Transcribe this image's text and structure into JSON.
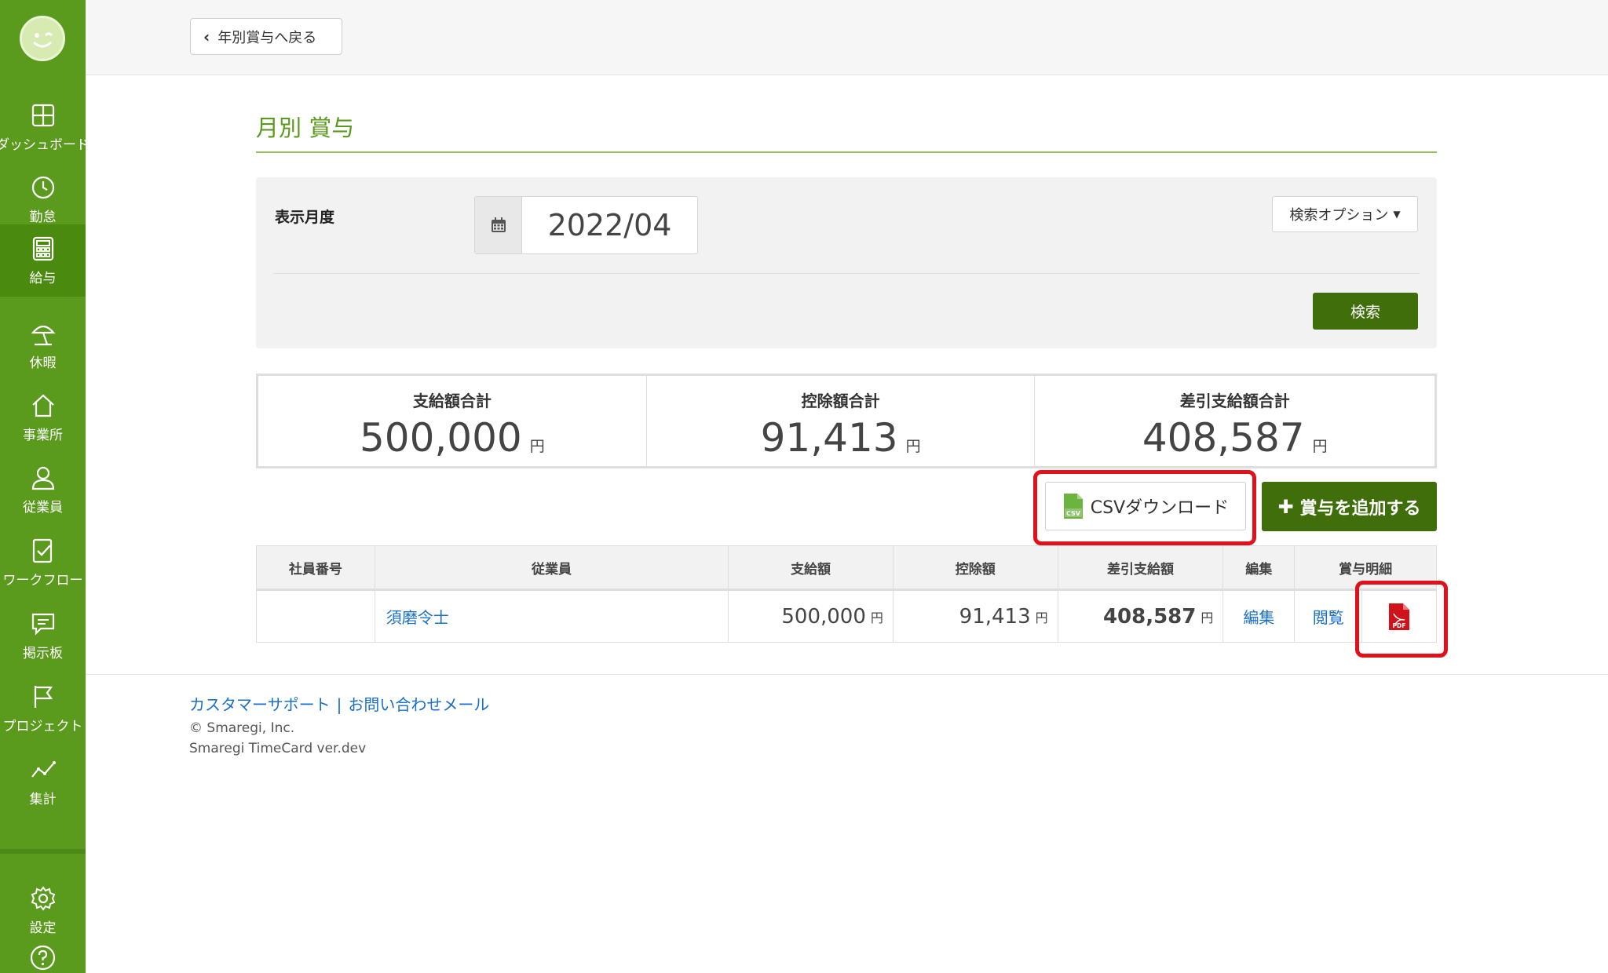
{
  "sidebar": {
    "items": [
      {
        "label": "ダッシュボード",
        "icon": "dashboard-icon"
      },
      {
        "label": "勤怠",
        "icon": "clock-icon"
      },
      {
        "label": "給与",
        "icon": "calculator-icon"
      },
      {
        "label": "休暇",
        "icon": "beach-umbrella-icon"
      },
      {
        "label": "事業所",
        "icon": "home-icon"
      },
      {
        "label": "従業員",
        "icon": "user-icon"
      },
      {
        "label": "ワークフロー",
        "icon": "checklist-icon"
      },
      {
        "label": "掲示板",
        "icon": "chat-icon"
      },
      {
        "label": "プロジェクト",
        "icon": "flag-icon"
      },
      {
        "label": "集計",
        "icon": "line-chart-icon"
      },
      {
        "label": "設定",
        "icon": "gear-icon"
      }
    ],
    "active_index": 2
  },
  "topbar": {
    "back_label": "年別賞与へ戻る"
  },
  "page": {
    "title": "月別 賞与"
  },
  "search": {
    "month_label": "表示月度",
    "month_value": "2022/04",
    "options_label": "検索オプション",
    "search_button": "検索"
  },
  "summary": [
    {
      "label": "支給額合計",
      "value": "500,000",
      "unit": "円"
    },
    {
      "label": "控除額合計",
      "value": "91,413",
      "unit": "円"
    },
    {
      "label": "差引支給額合計",
      "value": "408,587",
      "unit": "円"
    }
  ],
  "actions": {
    "csv_label": "CSVダウンロード",
    "add_label": "賞与を追加する"
  },
  "table": {
    "headers": [
      "社員番号",
      "従業員",
      "支給額",
      "控除額",
      "差引支給額",
      "編集",
      "賞与明細"
    ],
    "rows": [
      {
        "employee_no": "",
        "employee": "須磨令士",
        "payment": "500,000",
        "deduction": "91,413",
        "net": "408,587",
        "unit": "円",
        "edit": "編集",
        "view": "閲覧"
      }
    ]
  },
  "footer": {
    "support": "カスタマーサポート",
    "separator": "|",
    "contact": "お問い合わせメール",
    "copyright": "© Smaregi, Inc.",
    "version": "Smaregi TimeCard ver.dev"
  },
  "colors": {
    "brand_green": "#5a9a1d",
    "dark_green": "#3f6e0b",
    "link_blue": "#1a6fc9",
    "highlight_red": "#e0111a",
    "pdf_red": "#d0131a"
  }
}
